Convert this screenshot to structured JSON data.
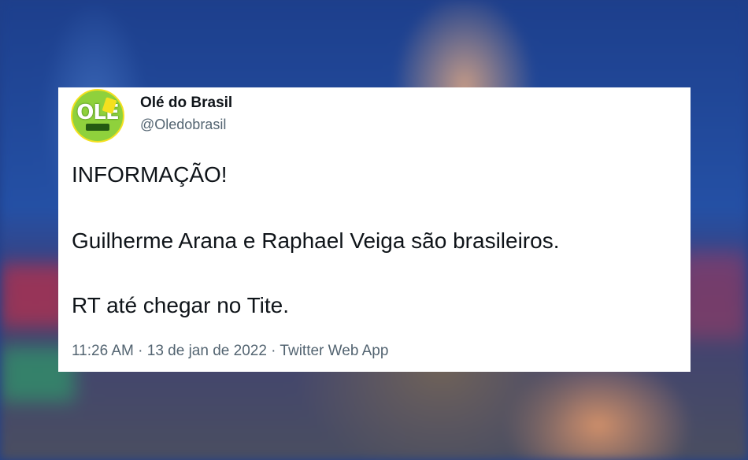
{
  "tweet": {
    "author": {
      "name": "Olé do Brasil",
      "handle": "@Oledobrasil",
      "avatar_icon": "ole-do-brasil-logo",
      "avatar_logo_text": "OLÉ"
    },
    "text_lines": [
      "INFORMAÇÃO!",
      "Guilherme Arana e Raphael Veiga são brasileiros.",
      "RT até chegar no Tite."
    ],
    "meta": "11:26 AM · 13 de jan de 2022 · Twitter Web App"
  },
  "colors": {
    "card_background": "#ffffff",
    "primary_text": "#0f1419",
    "secondary_text": "#536471",
    "avatar_green": "#8fd13c",
    "avatar_yellow": "#f4e01f"
  }
}
